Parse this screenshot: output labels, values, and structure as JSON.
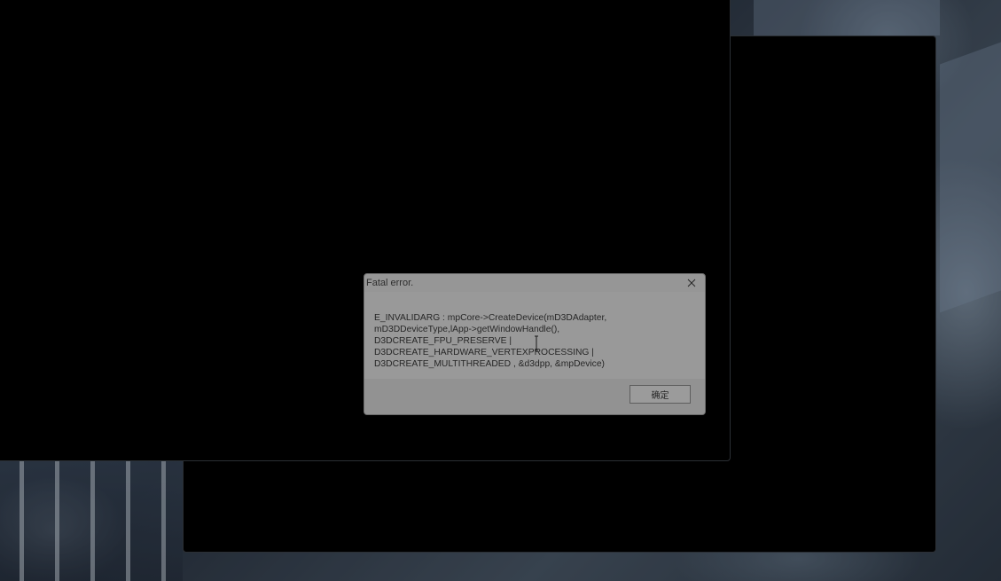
{
  "dialog": {
    "title": "Fatal error.",
    "message": "E_INVALIDARG : mpCore->CreateDevice(mD3DAdapter, mD3DDeviceType,lApp->getWindowHandle(), D3DCREATE_FPU_PRESERVE | D3DCREATE_HARDWARE_VERTEXPROCESSING | D3DCREATE_MULTITHREADED , &d3dpp, &mpDevice)",
    "ok_label": "确定"
  },
  "icons": {
    "close": "close-icon",
    "cursor": "mouse-cursor-icon"
  },
  "colors": {
    "dialog_bg": "#c9c9c9",
    "window_bg": "#000000"
  }
}
